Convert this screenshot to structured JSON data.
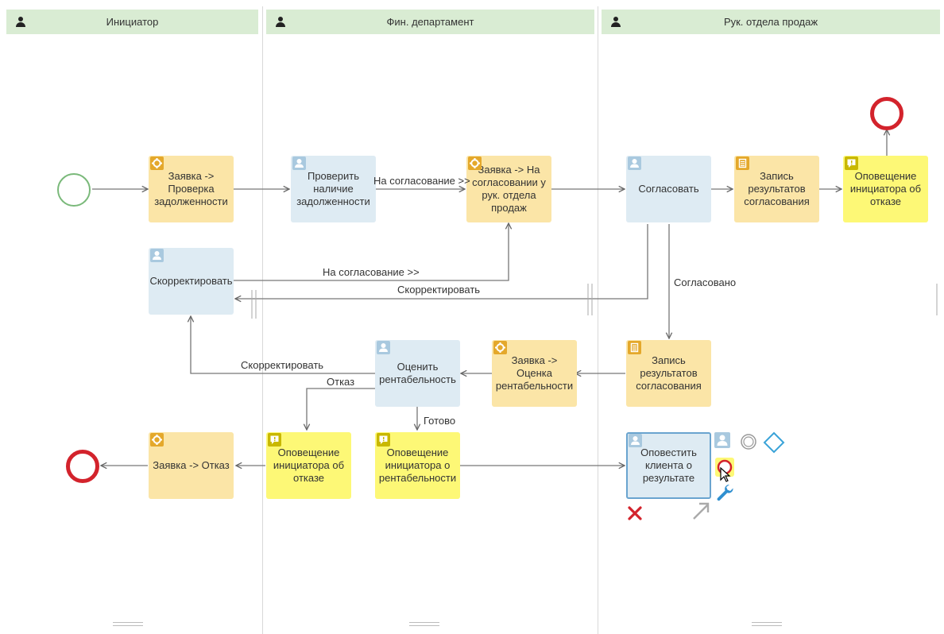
{
  "lanes": [
    {
      "title": "Инициатор"
    },
    {
      "title": "Фин. департамент"
    },
    {
      "title": "Рук. отдела продаж"
    }
  ],
  "tasks": {
    "zayavka_proverka": {
      "label": "Заявка -> Проверка задолженности",
      "kind": "service"
    },
    "proverit": {
      "label": "Проверить наличие задолженности",
      "kind": "user"
    },
    "zayavka_soglasovanie": {
      "label": "Заявка -> На согласовании у рук. отдела продаж",
      "kind": "service"
    },
    "soglasovat": {
      "label": "Согласовать",
      "kind": "user"
    },
    "zapis1": {
      "label": "Запись результатов согласования",
      "kind": "script"
    },
    "opoveshenie_otkaz_right": {
      "label": "Оповещение инициатора об отказе",
      "kind": "message"
    },
    "skorrektirovat": {
      "label": "Скорректировать",
      "kind": "user"
    },
    "ocenit": {
      "label": "Оценить рентабельность",
      "kind": "user"
    },
    "zayavka_ocenka": {
      "label": "Заявка -> Оценка рентабельности",
      "kind": "service"
    },
    "zapis2": {
      "label": "Запись результатов согласования",
      "kind": "script"
    },
    "zayavka_otkaz": {
      "label": "Заявка -> Отказ",
      "kind": "service"
    },
    "opoveshenie_otkaz_mid": {
      "label": "Оповещение инициатора об отказе",
      "kind": "message"
    },
    "opoveshenie_rent": {
      "label": "Оповещение инициатора о рентабельности",
      "kind": "message"
    },
    "opovestit_klienta": {
      "label": "Оповестить клиента о результате",
      "kind": "user"
    }
  },
  "edge_labels": {
    "na_soglasovanie_1": "На согласование >>",
    "na_soglasovanie_2": "На согласование >>",
    "skorrektirovat_1": "Скорректировать",
    "soglasovano": "Согласовано",
    "skorrektirovat_2": "Скорректировать",
    "otkaz": "Отказ",
    "gotovo": "Готово"
  },
  "context_tools": [
    "user-task-icon",
    "intermediate-event-icon",
    "gateway-icon",
    "end-event-icon",
    "wrench-icon",
    "delete-icon",
    "connect-arrow-icon"
  ],
  "colors": {
    "lane_header": "#d9ecd3",
    "service_task": "#fbe5a7",
    "user_task": "#deebf3",
    "message_task": "#fdf876",
    "start_event": "#7ab97a",
    "end_event": "#d3232c",
    "icon_badge": "#e4a82b"
  }
}
